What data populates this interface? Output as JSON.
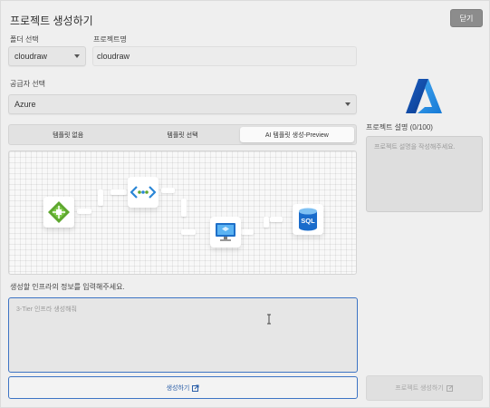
{
  "window": {
    "title": "프로젝트 생성하기",
    "close_label": "닫기"
  },
  "folder": {
    "label": "폴더 선택",
    "value": "cloudraw"
  },
  "project_name": {
    "label": "프로젝트명",
    "value": "cloudraw"
  },
  "provider": {
    "label": "공급자 선택",
    "value": "Azure"
  },
  "tabs": [
    {
      "label": "템플릿 없음",
      "active": false
    },
    {
      "label": "템플릿 선택",
      "active": false
    },
    {
      "label": "AI 템플릿 생성-Preview",
      "active": true
    }
  ],
  "diagram": {
    "nodes": [
      {
        "name": "application-gateway-icon"
      },
      {
        "name": "virtual-network-icon"
      },
      {
        "name": "virtual-machine-icon"
      },
      {
        "name": "sql-database-icon",
        "label": "SQL"
      }
    ]
  },
  "prompt": {
    "label": "생성할 인프라의 정보를 입력해주세요.",
    "placeholder": "3-Tier 인프라 생성해줘"
  },
  "generate_button": {
    "label": "생성하기"
  },
  "description": {
    "label": "프로젝트 설명 (0/100)",
    "placeholder": "프로젝트 설명을 작성해주세요."
  },
  "create_button": {
    "label": "프로젝트 생성하기"
  },
  "colors": {
    "accent": "#3d74c4",
    "close_button": "#8c8c8c"
  }
}
